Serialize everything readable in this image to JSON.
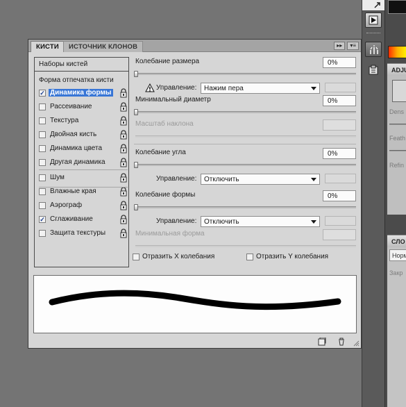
{
  "tabs": [
    {
      "label": "КИСТИ"
    },
    {
      "label": "ИСТОЧНИК КЛОНОВ"
    }
  ],
  "tab_controls": {
    "collapse": "▸▸",
    "menu": "▾≡"
  },
  "left": {
    "presets": "Наборы кистей",
    "tip_shape": "Форма отпечатка кисти",
    "items": [
      {
        "label": "Динамика формы",
        "checked": true,
        "selected": true
      },
      {
        "label": "Рассеивание",
        "checked": false
      },
      {
        "label": "Текстура",
        "checked": false
      },
      {
        "label": "Двойная кисть",
        "checked": false
      },
      {
        "label": "Динамика цвета",
        "checked": false
      },
      {
        "label": "Другая динамика",
        "checked": false
      },
      {
        "label": "Шум",
        "checked": false
      },
      {
        "label": "Влажные края",
        "checked": false
      },
      {
        "label": "Аэрограф",
        "checked": false
      },
      {
        "label": "Сглаживание",
        "checked": true
      },
      {
        "label": "Защита текстуры",
        "checked": false
      }
    ],
    "check_mark": "✓"
  },
  "settings": {
    "size_jitter": {
      "label": "Колебание размера",
      "value": "0%"
    },
    "control1": {
      "label": "Управление:",
      "value": "Нажим пера"
    },
    "min_diameter": {
      "label": "Минимальный диаметр",
      "value": "0%"
    },
    "tilt_scale": {
      "label": "Масштаб наклона"
    },
    "angle_jitter": {
      "label": "Колебание угла",
      "value": "0%"
    },
    "control2": {
      "label": "Управление:",
      "value": "Отключить"
    },
    "roundness_jitter": {
      "label": "Колебание формы",
      "value": "0%"
    },
    "control3": {
      "label": "Управление:",
      "value": "Отключить"
    },
    "min_roundness": {
      "label": "Минимальная форма"
    },
    "flip_x": {
      "label": "Отразить X колебания",
      "checked": false
    },
    "flip_y": {
      "label": "Отразить Y колебания",
      "checked": false
    }
  },
  "dock": {
    "adjustments_tab": "ADJU",
    "density": "Dens",
    "feather": "Feath",
    "refine": "Refin",
    "layers_tab": "СЛО",
    "blend_mode": "Норм",
    "lock": "Закр"
  },
  "icons": [
    "play-icon",
    "arrow-icon",
    "brush-panel-icon",
    "clone-source-icon",
    "warning-icon",
    "lock-icon",
    "new-preset-icon",
    "trash-icon",
    "resize-grip-icon"
  ],
  "colors": {
    "selection": "#3876d6",
    "panel": "#d6d6d6",
    "workspace": "#747474"
  }
}
